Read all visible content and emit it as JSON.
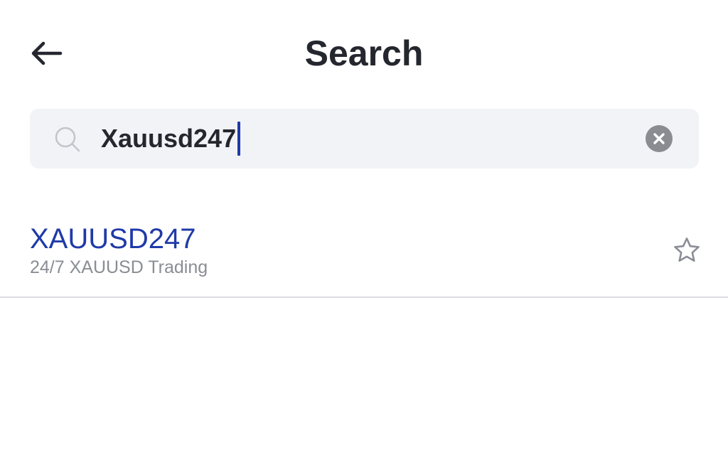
{
  "header": {
    "title": "Search",
    "back_icon": "arrow-left-icon"
  },
  "search": {
    "icon": "search-icon",
    "value": "Xauusd247",
    "clear_icon": "clear-circle-icon",
    "accent_color": "#1f3aa8"
  },
  "results": [
    {
      "symbol": "XAUUSD247",
      "description": "24/7 XAUUSD Trading",
      "favorite_icon": "star-outline-icon",
      "favorited": false
    }
  ],
  "colors": {
    "title": "#24272e",
    "symbol": "#1f3aa8",
    "description": "#8a8d94",
    "search_bg": "#f2f3f6"
  }
}
